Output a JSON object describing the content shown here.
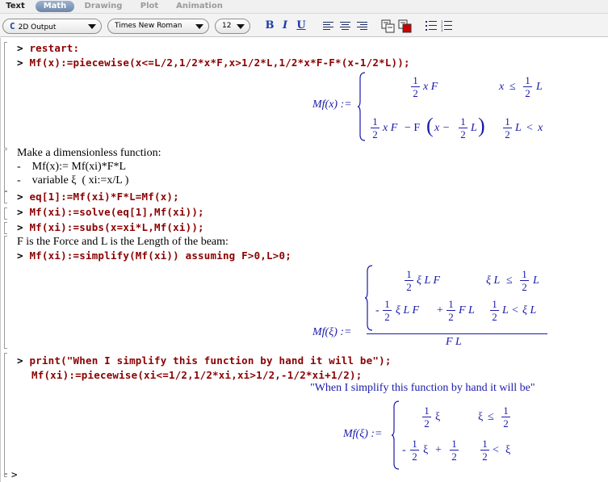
{
  "tabs": [
    {
      "label": "Text"
    },
    {
      "label": "Math"
    },
    {
      "label": "Drawing"
    },
    {
      "label": "Plot"
    },
    {
      "label": "Animation"
    }
  ],
  "toolbar": {
    "output_mode": "2D Output",
    "font": "Times New Roman",
    "size": "12",
    "bold": "B",
    "italic": "I",
    "underline": "U"
  },
  "doc": {
    "cmd1": "restart:",
    "cmd2": "Mf(x):=piecewise(x<=L/2,1/2*x*F,x>1/2*L,1/2*x*F-F*(x-1/2*L));",
    "out1_lhs": "Mf(x) :=",
    "text1": "Make a dimensionless function:",
    "text2": "-    Mf(x):= Mf(xi)*F*L",
    "text3": "-    variable ξ  ( xi:=x/L )",
    "cmd3": "eq[1]:=Mf(xi)*F*L=Mf(x);",
    "cmd4": "Mf(xi):=solve(eq[1],Mf(xi));",
    "cmd5": "Mf(xi):=subs(x=xi*L,Mf(xi));",
    "text4": "F is the Force and L is the Length of the beam:",
    "cmd6": "Mf(xi):=simplify(Mf(xi)) assuming F>0,L>0;",
    "out2_lhs": "Mf(ξ) :=",
    "cmd7": "print(\"When I simplify this function by hand it will be\");",
    "cmd8": "Mf(xi):=piecewise(xi<=1/2,1/2*xi,xi>1/2,-1/2*xi+1/2);",
    "out3_str": "\"When I simplify this function by hand it will be\"",
    "out4_lhs": "Mf(ξ) :="
  },
  "math": {
    "one": "1",
    "two": "2",
    "xF": "x F",
    "x": "x",
    "L": "L",
    "le": "≤",
    "lt": "<",
    "minus": "−",
    "plus": "+",
    "F": "F",
    "xi": "ξ",
    "xiL": "ξ L",
    "FL": "F L",
    "xiLF": "ξ L F",
    "lparen": "(",
    "rparen": ")",
    "minus_dash": "-",
    "F_minus": " − F",
    "x_minus": "x −"
  }
}
